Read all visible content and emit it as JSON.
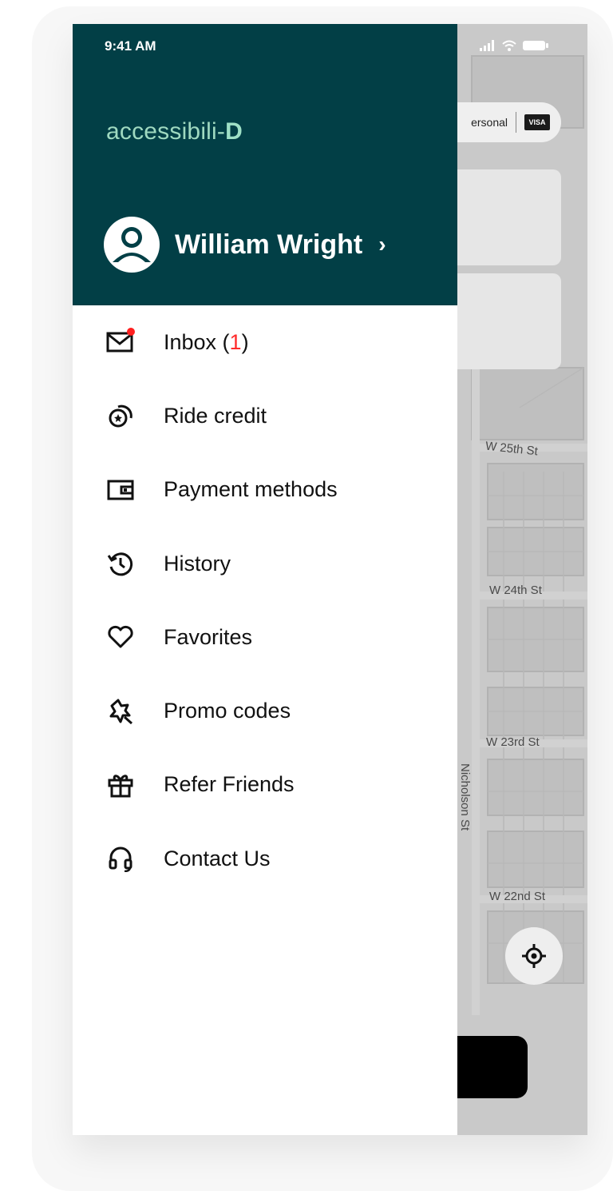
{
  "status_bar": {
    "time": "9:41 AM"
  },
  "app": {
    "logo_prefix": "accessibili-",
    "logo_suffix": "D"
  },
  "user": {
    "name": "William Wright",
    "chevron": "›"
  },
  "menu": {
    "inbox": {
      "label": "Inbox (",
      "count": "1",
      "close": ")",
      "icon": "mail-icon"
    },
    "items": [
      {
        "label": "Ride credit",
        "icon": "ride-credit-icon"
      },
      {
        "label": "Payment methods",
        "icon": "wallet-icon"
      },
      {
        "label": "History",
        "icon": "history-icon"
      },
      {
        "label": "Favorites",
        "icon": "heart-icon"
      },
      {
        "label": "Promo codes",
        "icon": "promo-icon"
      },
      {
        "label": "Refer Friends",
        "icon": "gift-icon"
      },
      {
        "label": "Contact Us",
        "icon": "headset-icon"
      }
    ]
  },
  "map": {
    "payment_pill": "ersonal",
    "card_brand": "VISA",
    "streets": [
      "W 25th St",
      "W 24th St",
      "W 23rd St",
      "Nicholson St",
      "W 22nd St"
    ]
  },
  "colors": {
    "header_bg": "#023f46",
    "logo": "#9fd9c0",
    "badge": "#ff1f1f"
  }
}
